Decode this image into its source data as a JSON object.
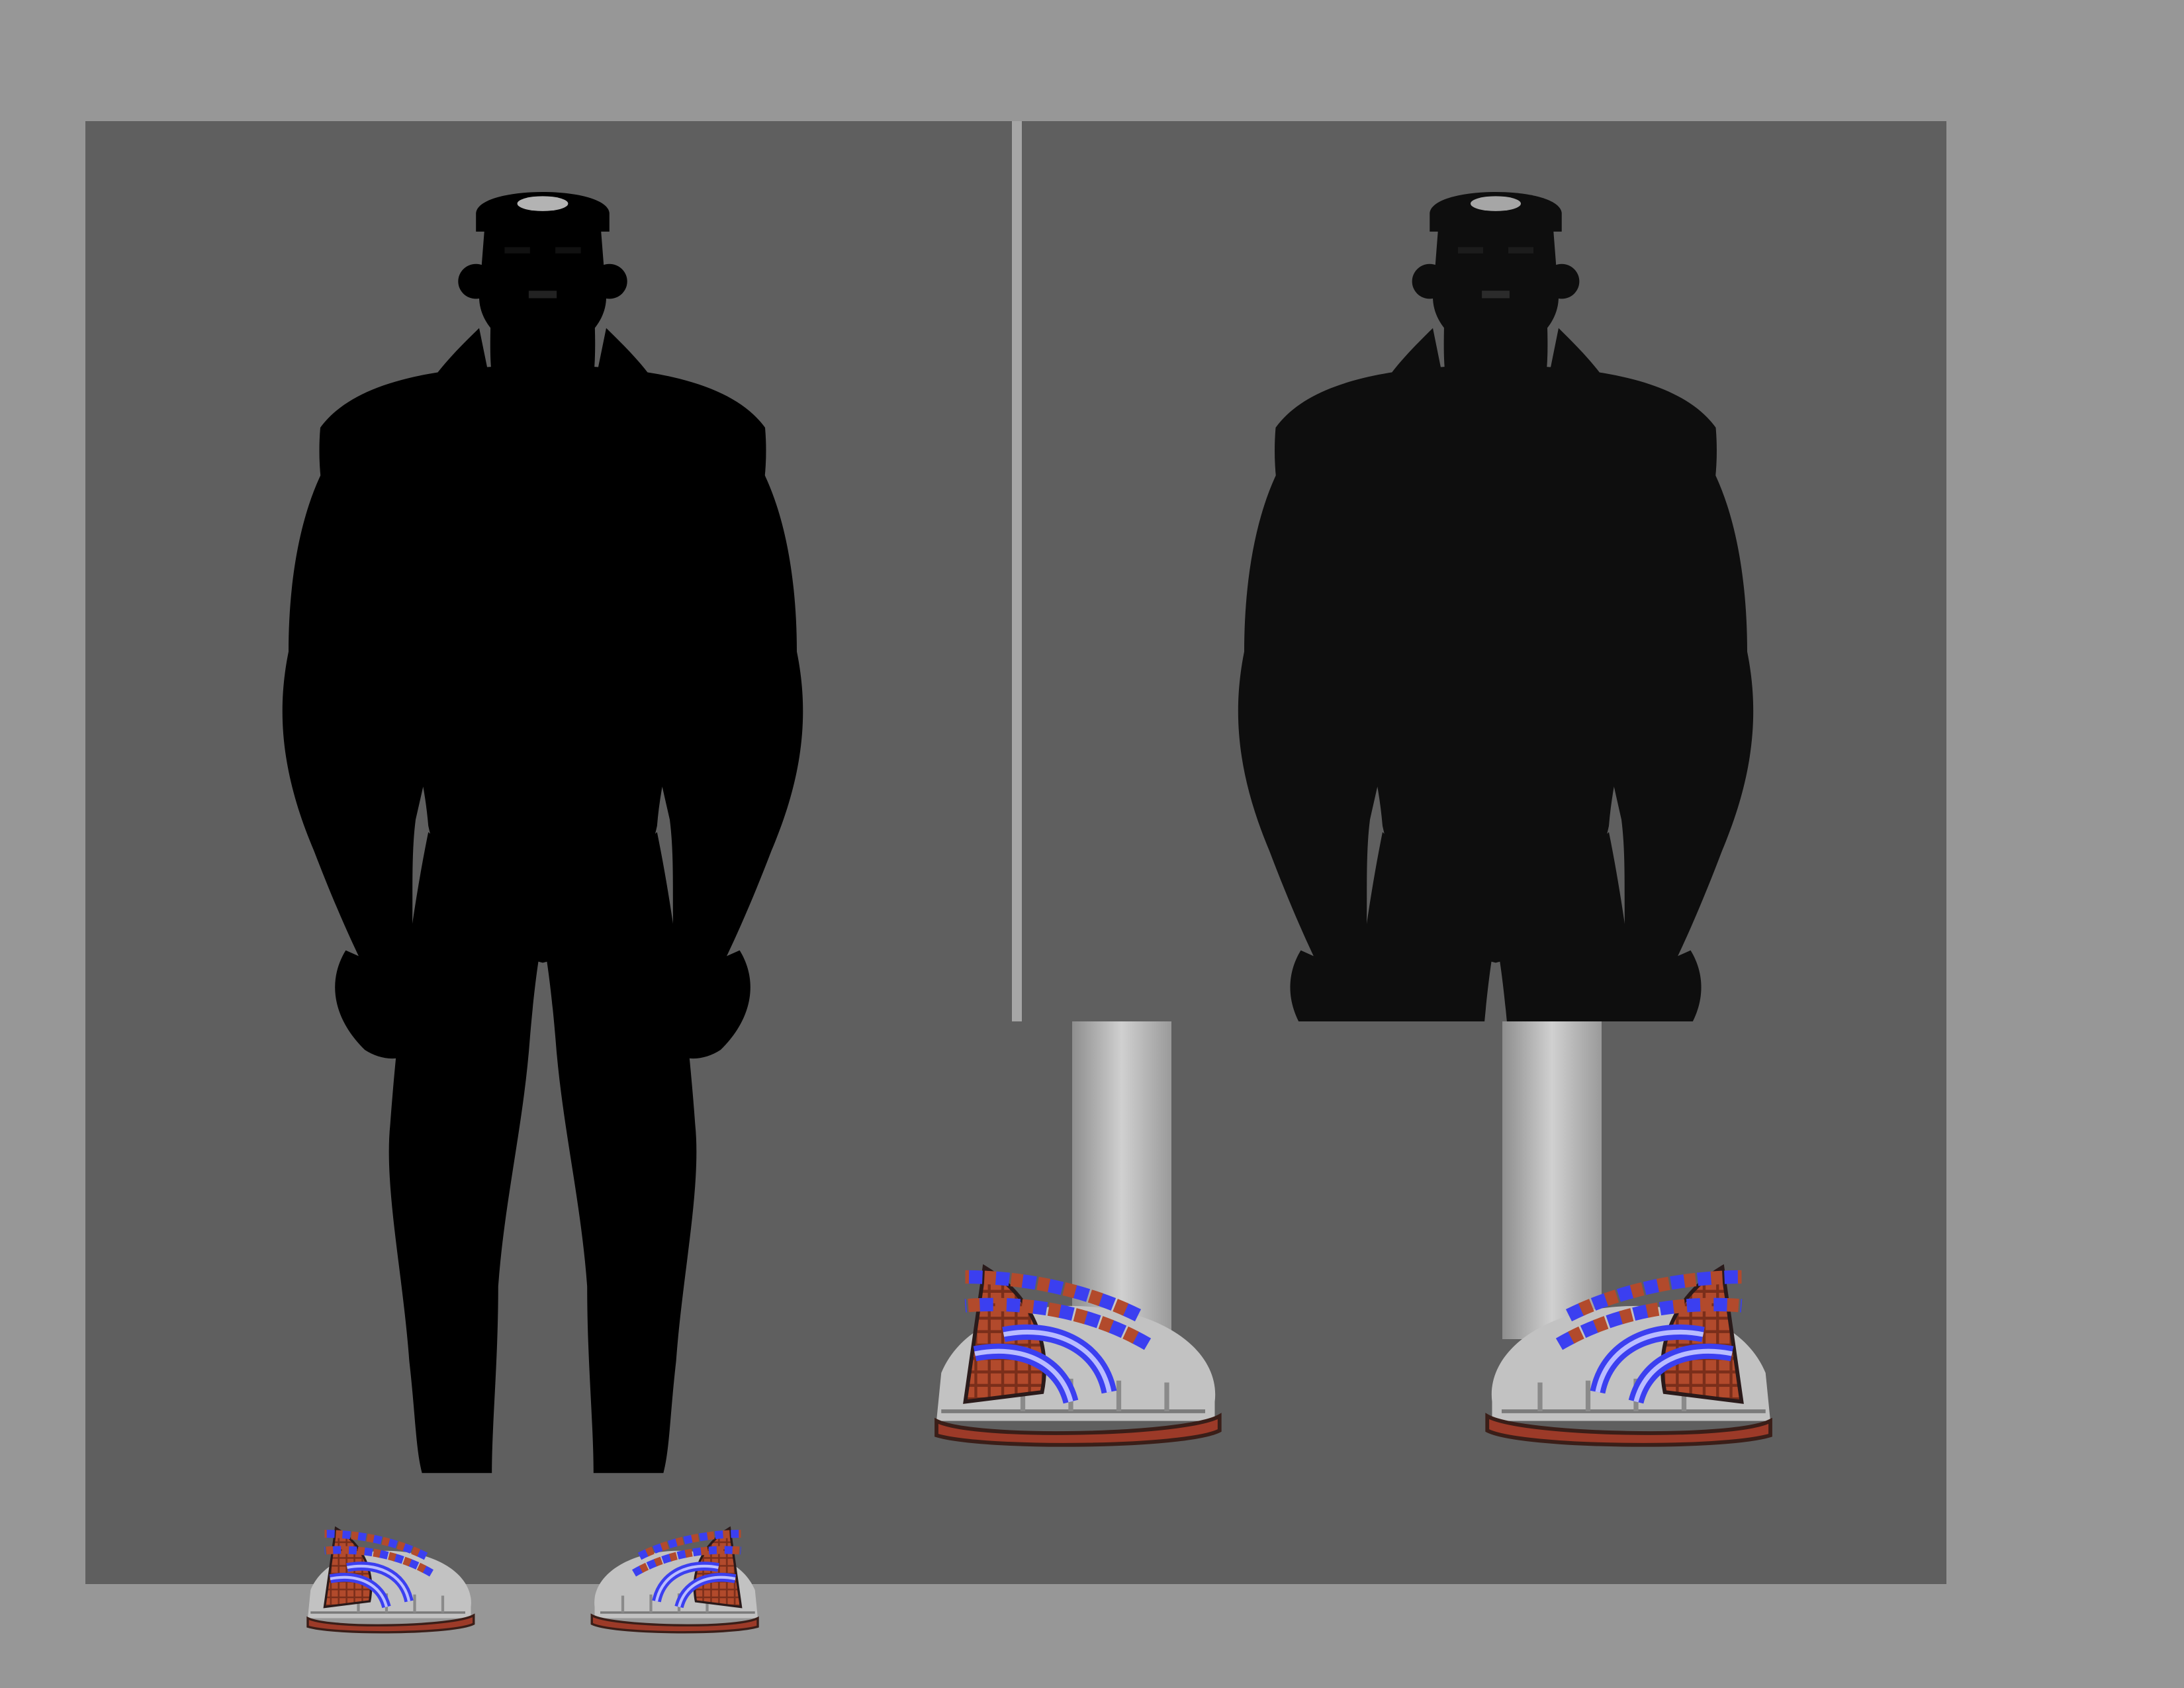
{
  "sheet": {
    "background": "#979797",
    "panel_color": "#5f5f5f",
    "divider_color": "#a6a6a6"
  },
  "panels": [
    {
      "name": "grayscale-front-view",
      "skin": "#c4c4c4",
      "beard": "#2c2c2c",
      "earring": "#e0e0e0"
    },
    {
      "name": "color-front-view",
      "skin": "#8a6450",
      "beard": "#3c4f7e",
      "earring": "#c9a23a"
    },
    {
      "name": "sandal-closeup",
      "skin": "#b9b9b9"
    }
  ],
  "sandal_palette": {
    "strap_blue": "#3b3ff0",
    "strap_highlight": "#b9bcff",
    "strap_red": "#b24a2c",
    "sole": "#9c3a28"
  }
}
